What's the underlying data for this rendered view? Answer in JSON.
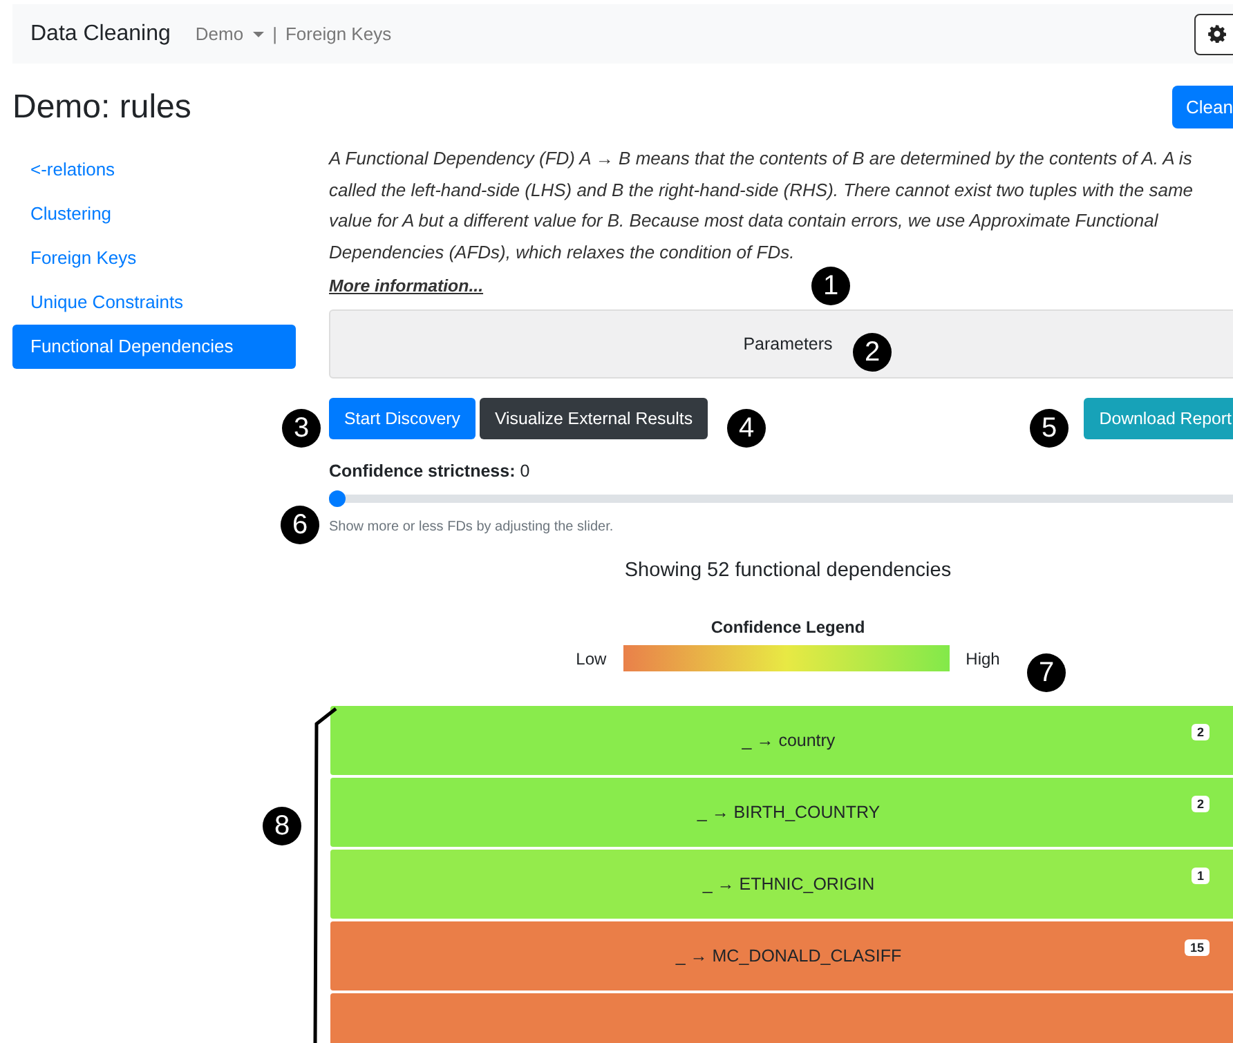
{
  "navbar": {
    "brand": "Data Cleaning",
    "dataset": "Demo",
    "separator": "|",
    "page": "Foreign Keys"
  },
  "heading": "Demo: rules",
  "clean_button": "Clean",
  "sidebar": {
    "items": [
      {
        "label": "<-relations",
        "selected": false
      },
      {
        "label": "Clustering",
        "selected": false
      },
      {
        "label": "Foreign Keys",
        "selected": false
      },
      {
        "label": "Unique Constraints",
        "selected": false
      },
      {
        "label": "Functional Dependencies",
        "selected": true
      }
    ]
  },
  "description": "A Functional Dependency (FD) A → B means that the contents of B are determined by the contents of A. A is called the left-hand-side (LHS) and B the right-hand-side (RHS). There cannot exist two tuples with the same value for A but a different value for B. Because most data contain errors, we use Approximate Functional Dependencies (AFDs), which relaxes the condition of FDs.",
  "more_link": "More information...",
  "parameters_panel": "Parameters",
  "buttons": {
    "start": "Start Discovery",
    "visualize": "Visualize External Results",
    "download": "Download Report"
  },
  "slider": {
    "label": "Confidence strictness:",
    "value": "0",
    "level": 0,
    "hint": "Show more or less FDs by adjusting the slider."
  },
  "summary": "Showing 52 functional dependencies",
  "legend": {
    "title": "Confidence Legend",
    "low": "Low",
    "high": "High"
  },
  "dependencies": [
    {
      "label": "_ → country",
      "count": "2",
      "color": "#89eb4c"
    },
    {
      "label": "_ → BIRTH_COUNTRY",
      "count": "2",
      "color": "#89eb4c"
    },
    {
      "label": "_ → ETHNIC_ORIGIN",
      "count": "1",
      "color": "#94eb4c"
    },
    {
      "label": "_ → MC_DONALD_CLASIFF",
      "count": "15",
      "color": "#ea7e48"
    },
    {
      "color": "#ea7e48"
    }
  ],
  "callouts": [
    {
      "label": "1"
    },
    {
      "label": "2"
    },
    {
      "label": "3"
    },
    {
      "label": "4"
    },
    {
      "label": "5"
    },
    {
      "label": "6"
    },
    {
      "label": "7"
    },
    {
      "label": "8"
    }
  ]
}
